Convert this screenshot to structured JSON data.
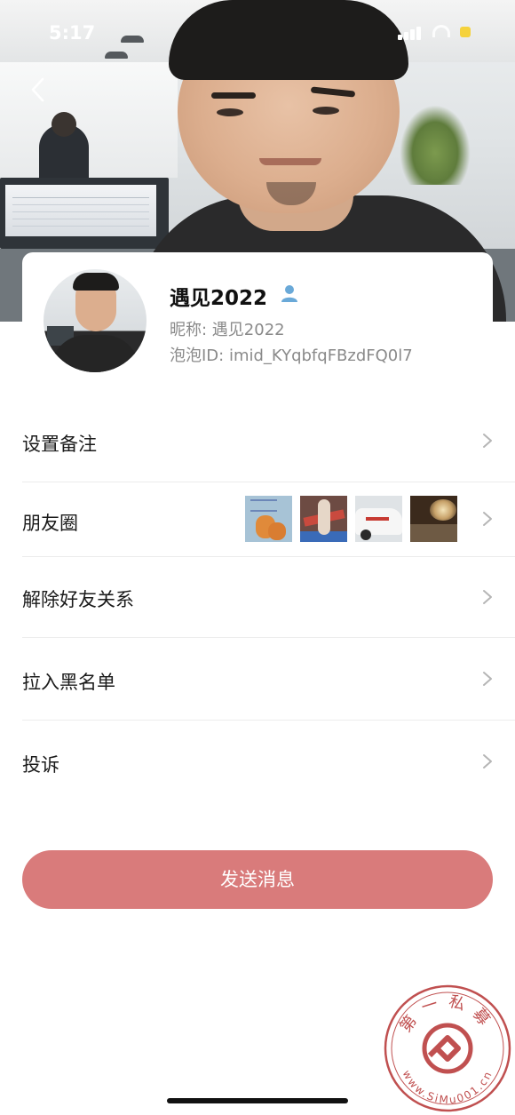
{
  "status_bar": {
    "time": "5:17"
  },
  "profile": {
    "display_name": "遇见2022",
    "nickname_label": "昵称: 遇见2022",
    "id_label": "泡泡ID: imid_KYqbfqFBzdFQ0l7"
  },
  "menu": [
    {
      "label": "设置备注"
    },
    {
      "label": "朋友圈"
    },
    {
      "label": "解除好友关系"
    },
    {
      "label": "拉入黑名单"
    },
    {
      "label": "投诉"
    }
  ],
  "actions": {
    "send_message": "发送消息"
  },
  "watermark": {
    "top_text": "第一私募",
    "bottom_text": "www.SiMu001.cn"
  },
  "icons": {
    "back": "chevron-left-icon",
    "user_badge": "user-icon",
    "chevron": "chevron-right-icon"
  },
  "colors": {
    "accent_button": "#d97b7b",
    "user_badge": "#6aa9d8",
    "watermark": "#c05050",
    "secondary_text": "#8a8a8a"
  }
}
